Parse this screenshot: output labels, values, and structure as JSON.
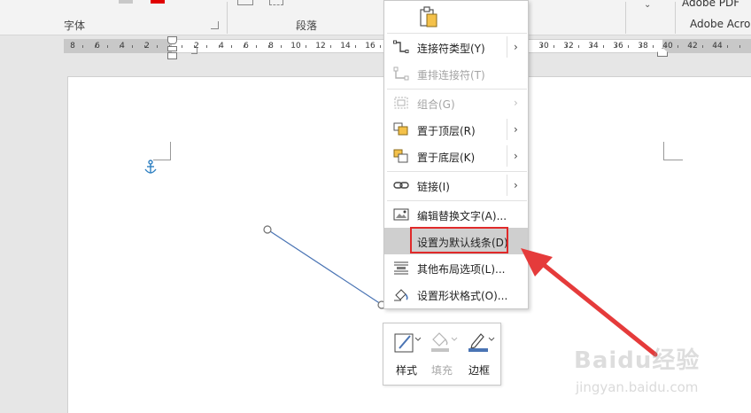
{
  "ribbon": {
    "font_group_label": "字体",
    "paragraph_group_label": "段落",
    "adobe_pdf_label": "Adobe PDF",
    "adobe_acrobat_label": "Adobe Acro"
  },
  "ruler": {
    "left_numbers": [
      "8",
      "6",
      "4",
      "2"
    ],
    "right_numbers": [
      "2",
      "4",
      "6",
      "8",
      "10",
      "12",
      "14",
      "16",
      "30",
      "32",
      "34",
      "36",
      "38",
      "40",
      "42",
      "44"
    ]
  },
  "context_menu": {
    "items": [
      {
        "label": "连接符类型(Y)",
        "disabled": false,
        "submenu": true,
        "icon": "connector-type-icon"
      },
      {
        "label": "重排连接符(T)",
        "disabled": true,
        "submenu": false,
        "icon": "reroute-connectors-icon"
      },
      {
        "label": "组合(G)",
        "disabled": true,
        "submenu": true,
        "icon": "group-icon"
      },
      {
        "label": "置于顶层(R)",
        "disabled": false,
        "submenu": true,
        "icon": "bring-to-front-icon"
      },
      {
        "label": "置于底层(K)",
        "disabled": false,
        "submenu": true,
        "icon": "send-to-back-icon"
      },
      {
        "label": "链接(I)",
        "disabled": false,
        "submenu": true,
        "icon": "link-icon"
      },
      {
        "label": "编辑替换文字(A)...",
        "disabled": false,
        "submenu": false,
        "icon": "alt-text-icon"
      },
      {
        "label": "设置为默认线条(D)",
        "disabled": false,
        "submenu": false,
        "icon": "",
        "highlighted": true
      },
      {
        "label": "其他布局选项(L)...",
        "disabled": false,
        "submenu": false,
        "icon": "layout-options-icon"
      },
      {
        "label": "设置形状格式(O)...",
        "disabled": false,
        "submenu": false,
        "icon": "format-shape-icon"
      }
    ]
  },
  "mini_toolbar": {
    "style_label": "样式",
    "fill_label": "填充",
    "outline_label": "边框"
  },
  "watermark": {
    "brand": "Baidu经验",
    "url": "jingyan.baidu.com"
  },
  "colors": {
    "highlight_box": "#e02a2a",
    "arrow": "#e53b3b",
    "line": "#4a74b4",
    "anchor": "#2d7fc1"
  }
}
